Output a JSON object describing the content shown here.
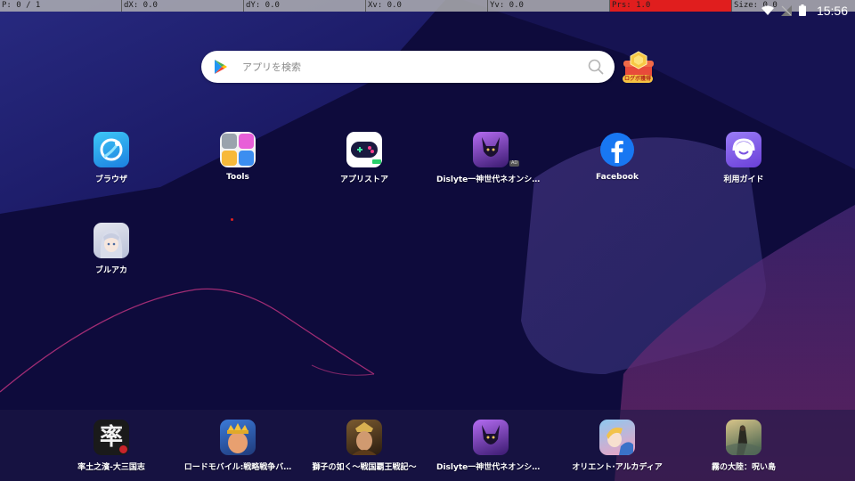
{
  "debug": [
    {
      "text": "P: 0 / 1",
      "alert": false
    },
    {
      "text": "dX: 0.0",
      "alert": false
    },
    {
      "text": "dY: 0.0",
      "alert": false
    },
    {
      "text": "Xv: 0.0",
      "alert": false
    },
    {
      "text": "Yv: 0.0",
      "alert": false
    },
    {
      "text": "Prs: 1.0",
      "alert": true
    },
    {
      "text": "Size: 0.0",
      "alert": false
    }
  ],
  "status": {
    "time": "15:56",
    "icons": [
      "wifi-icon",
      "no-sim-icon",
      "battery-icon"
    ]
  },
  "search": {
    "placeholder": "アプリを検索"
  },
  "login_bonus": {
    "label": "ログボ獲得"
  },
  "home_apps": [
    {
      "label": "ブラウザ",
      "icon": "browser-icon"
    },
    {
      "label": "Tools",
      "icon": "tools-icon"
    },
    {
      "label": "アプリストア",
      "icon": "app-store-icon"
    },
    {
      "label": "Dislyte一神世代ネオンシティ…",
      "icon": "dislyte-icon",
      "badge": "AD"
    },
    {
      "label": "Facebook",
      "icon": "facebook-icon"
    },
    {
      "label": "利用ガイド",
      "icon": "guide-icon"
    },
    {
      "label": "ブルアカ",
      "icon": "blue-archive-icon"
    }
  ],
  "dock_apps": [
    {
      "label": "率土之濱-大三国志",
      "icon": "sanguo-icon",
      "glyph": "率"
    },
    {
      "label": "ロードモバイル:戦略戦争バ…",
      "icon": "lords-mobile-icon"
    },
    {
      "label": "獅子の如く〜戦国覇王戦記〜",
      "icon": "shishi-icon"
    },
    {
      "label": "Dislyte一神世代ネオンシティ…",
      "icon": "dislyte-icon"
    },
    {
      "label": "オリエント·アルカディア",
      "icon": "orient-arcadia-icon"
    },
    {
      "label": "霧の大陸：呪い島",
      "icon": "mist-continent-icon"
    }
  ],
  "colors": {
    "background": "#0e0b3c",
    "accent": "#e01e1e",
    "search_bg": "#ffffff"
  }
}
